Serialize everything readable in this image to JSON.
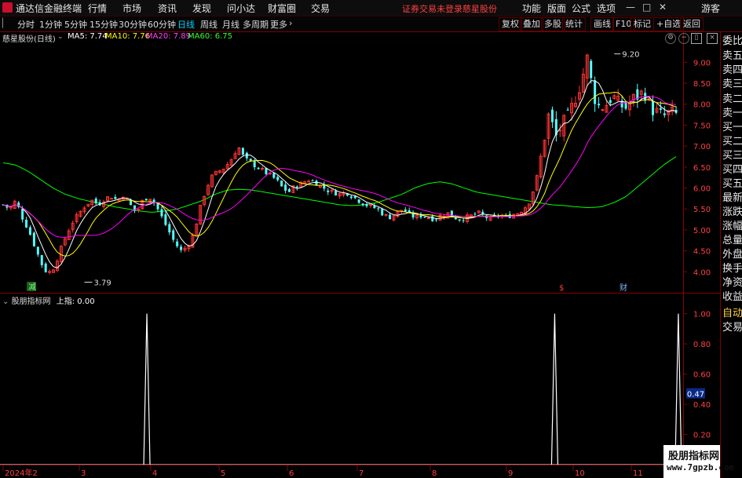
{
  "app": {
    "title": "通达信金融终端"
  },
  "menu": [
    "行情",
    "市场",
    "资讯",
    "发现",
    "问小达",
    "财富圈",
    "交易"
  ],
  "warning": "证券交易未登录",
  "stock_name_top": "慈星股份",
  "top_right": [
    "功能",
    "版面",
    "公式",
    "选项"
  ],
  "guest": "游客",
  "periods": [
    "分时",
    "1分钟",
    "5分钟",
    "15分钟",
    "30分钟",
    "60分钟",
    "日线",
    "周线",
    "月线",
    "多周期",
    "更多"
  ],
  "active_period": "日线",
  "tools": [
    "复权",
    "叠加",
    "多股",
    "统计",
    "画线",
    "F10",
    "标记",
    "+自选",
    "返回"
  ],
  "info": {
    "title": "慈星股份(日线)",
    "ma5": "MA5: 7.74",
    "ma10": "MA10: 7.76",
    "ma20": "MA20: 7.89",
    "ma60": "MA60: 6.75"
  },
  "sub_info": {
    "title": "股朋指标网",
    "value": "上指: 0.00"
  },
  "right_panel": [
    "委比",
    "卖五",
    "卖四",
    "卖三",
    "卖二",
    "卖一",
    "买一",
    "买二",
    "买三",
    "买四",
    "买五",
    "最新",
    "涨跌",
    "涨幅",
    "总量",
    "外盘",
    "换手",
    "净资",
    "收益",
    "自动",
    "交易"
  ],
  "markers": {
    "low_label": "3.79",
    "high_label": "9.20",
    "mark_jian": "减",
    "mark_cai": "财",
    "mark_s": "$"
  },
  "watermark": {
    "line1": "股朋指标网",
    "line2": "www.7gpzb.com"
  },
  "colors": {
    "up": "#ff3232",
    "down": "#54ffff",
    "ma5": "#ffffff",
    "ma10": "#ffff00",
    "ma20": "#ff00ff",
    "ma60": "#00ff00",
    "sub": "#ffffff"
  },
  "chart_data": [
    {
      "type": "candlestick",
      "title": "",
      "ylim": [
        3.5,
        9.4
      ],
      "yticks": [
        "9.00",
        "8.50",
        "8.00",
        "7.50",
        "7.00",
        "6.50",
        "6.00",
        "5.50",
        "5.00",
        "4.50",
        "4.00"
      ],
      "xticks": [
        "2024年2",
        "3",
        "4",
        "5",
        "6",
        "7",
        "8",
        "9",
        "10",
        "11"
      ],
      "close_path": [
        5.6,
        5.5,
        5.7,
        5.3,
        5.0,
        4.6,
        4.2,
        3.95,
        4.1,
        4.5,
        4.9,
        5.2,
        5.4,
        5.6,
        5.7,
        5.6,
        5.75,
        5.8,
        5.7,
        5.85,
        5.6,
        5.4,
        5.7,
        5.8,
        5.6,
        5.3,
        5.0,
        4.7,
        4.5,
        4.6,
        4.9,
        5.5,
        6.0,
        6.3,
        6.4,
        6.5,
        6.7,
        7.0,
        6.7,
        6.6,
        6.5,
        6.4,
        6.3,
        6.2,
        6.0,
        5.9,
        6.05,
        6.1,
        6.2,
        6.15,
        6.05,
        5.95,
        5.9,
        5.85,
        5.9,
        5.8,
        5.7,
        5.6,
        5.55,
        5.5,
        5.35,
        5.3,
        5.4,
        5.5,
        5.35,
        5.3,
        5.35,
        5.3,
        5.25,
        5.35,
        5.4,
        5.3,
        5.25,
        5.3,
        5.35,
        5.4,
        5.3,
        5.25,
        5.35,
        5.3,
        5.35,
        5.4,
        5.5,
        5.7,
        6.2,
        7.0,
        7.8,
        7.2,
        7.5,
        7.7,
        8.1,
        8.5,
        9.1,
        8.2,
        7.9,
        8.0,
        8.2,
        8.0,
        7.9,
        8.1,
        8.2,
        8.3,
        7.9,
        7.8,
        7.7,
        7.8,
        7.75
      ],
      "ma60_path": [
        6.6,
        6.55,
        6.4,
        6.2,
        6.0,
        5.85,
        5.75,
        5.68,
        5.62,
        5.55,
        5.5,
        5.45,
        5.42,
        5.45,
        5.5,
        5.6,
        5.7,
        5.85,
        5.95,
        5.97,
        5.95,
        5.9,
        5.85,
        5.8,
        5.75,
        5.7,
        5.65,
        5.6,
        5.58,
        5.6,
        5.65,
        5.75,
        5.85,
        6.0,
        6.1,
        6.15,
        6.1,
        6.0,
        5.9,
        5.85,
        5.8,
        5.75,
        5.7,
        5.65,
        5.6,
        5.58,
        5.55,
        5.53,
        5.55,
        5.65,
        5.8,
        6.05,
        6.3,
        6.55,
        6.75
      ],
      "lows": [
        {
          "label": "3.79",
          "value": 3.79
        }
      ],
      "highs": [
        {
          "label": "9.20",
          "value": 9.2
        }
      ]
    },
    {
      "type": "line",
      "title": "",
      "ylim": [
        0,
        1.05
      ],
      "yticks": [
        "1.00",
        "0.80",
        "0.60",
        "0.40",
        "0.20"
      ],
      "highlight_value": "0.47",
      "spikes_at_fraction": [
        0.215,
        0.812,
        0.993
      ],
      "values": [
        0,
        1,
        0,
        1,
        0,
        1,
        0
      ]
    }
  ]
}
